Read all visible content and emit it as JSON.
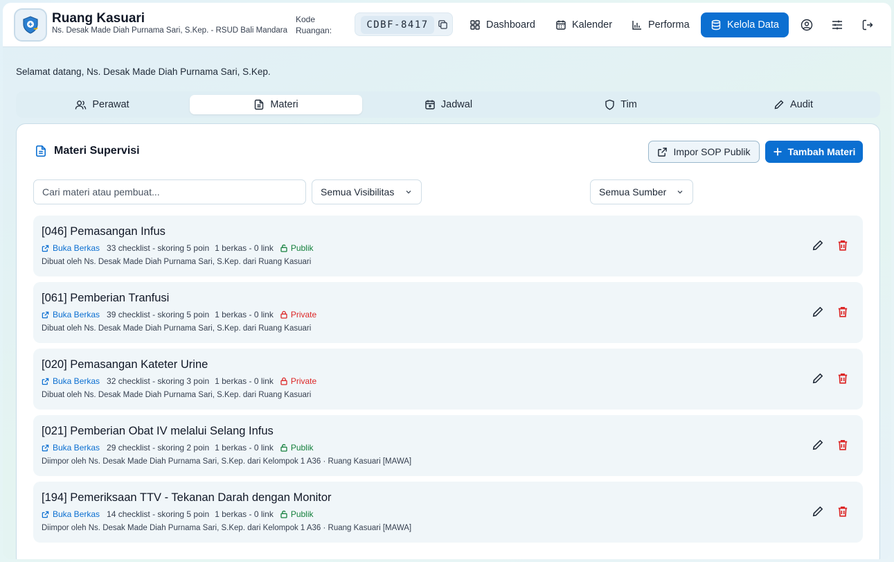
{
  "header": {
    "title": "Ruang Kasuari",
    "subtitle": "Ns. Desak Made Diah Purnama Sari, S.Kep. - RSUD Bali Mandara",
    "room_code_label": "Kode Ruangan:",
    "room_code": "CDBF-8417",
    "nav": [
      {
        "label": "Dashboard",
        "icon": "grid-icon"
      },
      {
        "label": "Kalender",
        "icon": "calendar-icon"
      },
      {
        "label": "Performa",
        "icon": "bar-chart-icon"
      },
      {
        "label": "Kelola Data",
        "icon": "database-icon",
        "active": true
      }
    ],
    "accent_color": "#0b6fd1"
  },
  "welcome": "Selamat datang, Ns. Desak Made Diah Purnama Sari, S.Kep.",
  "tabs": [
    {
      "label": "Perawat",
      "icon": "users-icon"
    },
    {
      "label": "Materi",
      "icon": "document-icon",
      "active": true
    },
    {
      "label": "Jadwal",
      "icon": "calendar-icon"
    },
    {
      "label": "Tim",
      "icon": "shield-icon"
    },
    {
      "label": "Audit",
      "icon": "pencil-icon"
    }
  ],
  "card": {
    "title": "Materi Supervisi",
    "import_button": "Impor SOP Publik",
    "add_button": "Tambah Materi",
    "search_placeholder": "Cari materi atau pembuat...",
    "visibility_filter": "Semua Visibilitas",
    "source_filter": "Semua Sumber"
  },
  "materials": [
    {
      "title": "[046] Pemasangan Infus",
      "link": "Buka Berkas",
      "checklist": "33 checklist - skoring 5 poin",
      "files": "1 berkas - 0 link",
      "visibility": "Publik",
      "creator": "Dibuat oleh Ns. Desak Made Diah Purnama Sari, S.Kep. dari Ruang Kasuari"
    },
    {
      "title": "[061] Pemberian Tranfusi",
      "link": "Buka Berkas",
      "checklist": "39 checklist - skoring 5 poin",
      "files": "1 berkas - 0 link",
      "visibility": "Private",
      "creator": "Dibuat oleh Ns. Desak Made Diah Purnama Sari, S.Kep. dari Ruang Kasuari"
    },
    {
      "title": "[020] Pemasangan Kateter Urine",
      "link": "Buka Berkas",
      "checklist": "32 checklist - skoring 3 poin",
      "files": "1 berkas - 0 link",
      "visibility": "Private",
      "creator": "Dibuat oleh Ns. Desak Made Diah Purnama Sari, S.Kep. dari Ruang Kasuari"
    },
    {
      "title": "[021] Pemberian Obat IV melalui Selang Infus",
      "link": "Buka Berkas",
      "checklist": "29 checklist - skoring 2 poin",
      "files": "1 berkas - 0 link",
      "visibility": "Publik",
      "creator": "Diimpor oleh Ns. Desak Made Diah Purnama Sari, S.Kep. dari Kelompok 1 A36 · Ruang Kasuari [MAWA]"
    },
    {
      "title": "[194] Pemeriksaan TTV - Tekanan Darah dengan Monitor",
      "link": "Buka Berkas",
      "checklist": "14 checklist - skoring 5 poin",
      "files": "1 berkas - 0 link",
      "visibility": "Publik",
      "creator": "Diimpor oleh Ns. Desak Made Diah Purnama Sari, S.Kep. dari Kelompok 1 A36 · Ruang Kasuari [MAWA]"
    }
  ],
  "colors": {
    "public": "#15803d",
    "private": "#dc2626",
    "delete": "#dc2626"
  }
}
